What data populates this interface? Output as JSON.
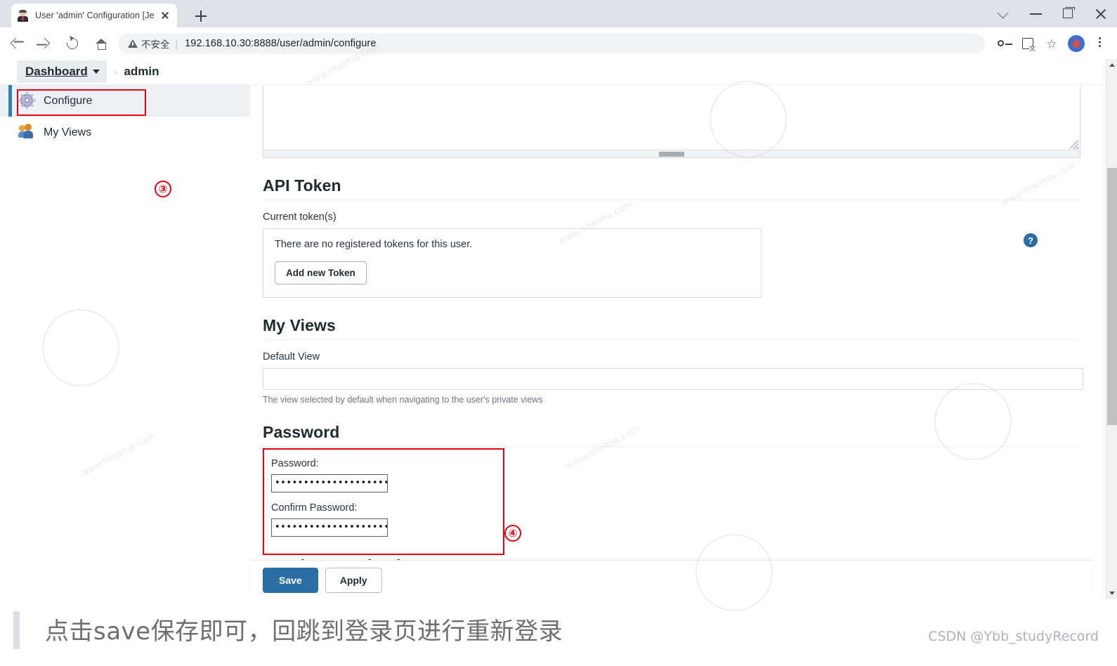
{
  "browser": {
    "tab": {
      "title": "User 'admin' Configuration [Je",
      "favicon_name": "jenkins-butler-favicon",
      "close_label": ""
    },
    "new_tab_label": "",
    "window_controls": [
      "chevron-down",
      "minimize",
      "maximize",
      "close"
    ],
    "toolbar": {
      "back_label": "",
      "forward_label": "",
      "reload_label": "",
      "home_label": "",
      "insecure_label": "不安全",
      "separator": "|",
      "url": "192.168.10.30:8888/user/admin/configure",
      "icons": [
        "key-icon",
        "translate-icon",
        "star-icon",
        "profile-avatar",
        "kebab-menu"
      ]
    }
  },
  "breadcrumb": {
    "dashboard": "Dashboard",
    "separator": "›",
    "current": "admin"
  },
  "sidebar": {
    "items": [
      {
        "label": "Configure",
        "icon": "gear-icon",
        "active": true
      },
      {
        "label": "My Views",
        "icon": "users-icon",
        "active": false
      }
    ],
    "annotation_marker": "③"
  },
  "main": {
    "description_textarea": {
      "value": ""
    },
    "api_token": {
      "heading": "API Token",
      "current_tokens_label": "Current token(s)",
      "empty_message": "There are no registered tokens for this user.",
      "add_button": "Add new Token",
      "help_icon": "?"
    },
    "my_views": {
      "heading": "My Views",
      "default_view_label": "Default View",
      "default_view_value": "",
      "help_text": "The view selected by default when navigating to the user's private views"
    },
    "password": {
      "heading": "Password",
      "password_label": "Password:",
      "password_value": "•••••••••••••••••••••••••",
      "confirm_label": "Confirm Password:",
      "confirm_value": "•••••••••••••••••••••••••",
      "annotation_marker": "④"
    },
    "session_termination": {
      "heading": "Session Termination"
    }
  },
  "footer": {
    "save_label": "Save",
    "apply_label": "Apply"
  },
  "caption": {
    "text": "点击save保存即可，回跳到登录页进行重新登录",
    "watermark": "CSDN @Ybb_studyRecord"
  },
  "colors": {
    "accent_blue": "#2a6ea3",
    "sidebar_accent": "#2f81c6",
    "annotation_red": "#e60012"
  }
}
